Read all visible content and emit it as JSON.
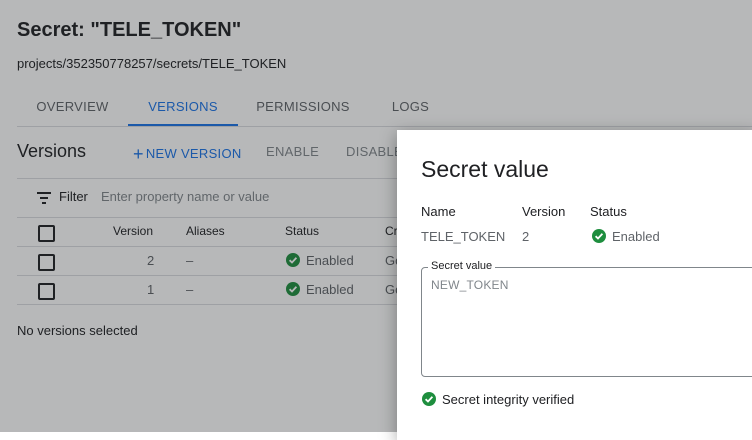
{
  "page": {
    "title": "Secret: \"TELE_TOKEN\"",
    "path": "projects/352350778257/secrets/TELE_TOKEN"
  },
  "tabs": [
    {
      "label": "OVERVIEW"
    },
    {
      "label": "VERSIONS",
      "active": true
    },
    {
      "label": "PERMISSIONS"
    },
    {
      "label": "LOGS"
    }
  ],
  "versions": {
    "title": "Versions",
    "new_version_label": "NEW VERSION",
    "enable_label": "ENABLE",
    "disable_label": "DISABLE",
    "filter_label": "Filter",
    "filter_placeholder": "Enter property name or value",
    "columns": {
      "version": "Version",
      "aliases": "Aliases",
      "status": "Status",
      "created": "Cre"
    },
    "rows": [
      {
        "version": "2",
        "aliases": "–",
        "status": "Enabled",
        "created": "Go"
      },
      {
        "version": "1",
        "aliases": "–",
        "status": "Enabled",
        "created": "Go"
      }
    ],
    "selection_text": "No versions selected"
  },
  "dialog": {
    "title": "Secret value",
    "headers": {
      "name": "Name",
      "version": "Version",
      "status": "Status"
    },
    "name": "TELE_TOKEN",
    "version": "2",
    "status": "Enabled",
    "field_label": "Secret value",
    "field_value": "NEW_TOKEN",
    "integrity_text": "Secret integrity verified"
  },
  "colors": {
    "accent": "#1a73e8",
    "success": "#1e8e3e"
  },
  "icons": [
    "plus-icon",
    "filter-icon",
    "check-circle-icon"
  ]
}
